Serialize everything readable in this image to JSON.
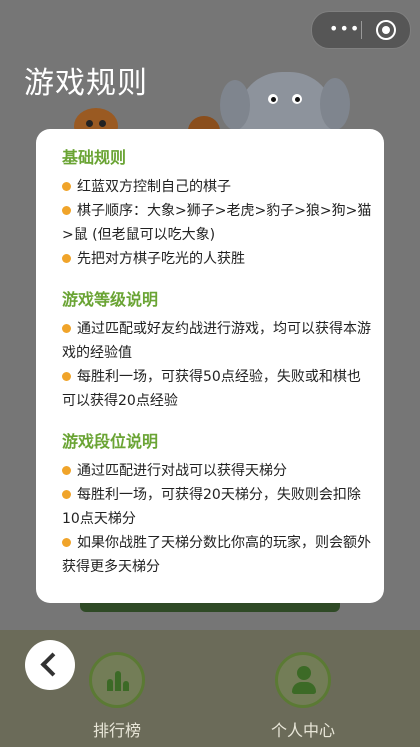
{
  "page_title": "游戏规则",
  "rules": [
    {
      "title": "基础规则",
      "items": [
        "红蓝双方控制自己的棋子",
        "棋子顺序：大象>狮子>老虎>豹子>狼>狗>猫>鼠 (但老鼠可以吃大象)",
        "先把对方棋子吃光的人获胜"
      ]
    },
    {
      "title": "游戏等级说明",
      "items": [
        "通过匹配或好友约战进行游戏，均可以获得本游戏的经验值",
        "每胜利一场，可获得50点经验，失败或和棋也可以获得20点经验"
      ]
    },
    {
      "title": "游戏段位说明",
      "items": [
        "通过匹配进行对战可以获得天梯分",
        "每胜利一场，可获得20天梯分，失败则会扣除10点天梯分",
        "如果你战胜了天梯分数比你高的玩家，则会额外获得更多天梯分"
      ]
    }
  ],
  "bottom_nav": {
    "ranking_label": "排行榜",
    "profile_label": "个人中心"
  },
  "icons": {
    "back": "chevron-left-icon",
    "ranking": "bar-chart-icon",
    "profile": "person-icon",
    "menu": "more-dots-icon",
    "close": "target-circle-icon"
  },
  "colors": {
    "section_title": "#6aa434",
    "bullet": "#f0a42a",
    "card": "#ffffff",
    "overlay": "#767676"
  }
}
